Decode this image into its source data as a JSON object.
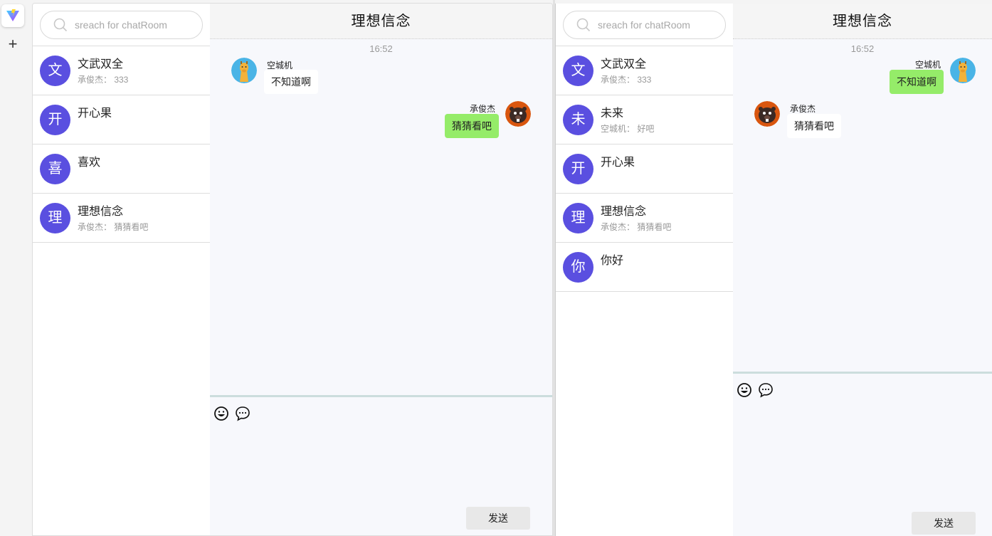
{
  "left_window": {
    "search": {
      "placeholder": "sreach for chatRoom"
    },
    "rooms": [
      {
        "avatar": "文",
        "name": "文武双全",
        "last": "承俊杰：  333"
      },
      {
        "avatar": "开",
        "name": "开心果",
        "last": ""
      },
      {
        "avatar": "喜",
        "name": "喜欢",
        "last": ""
      },
      {
        "avatar": "理",
        "name": "理想信念",
        "last": "承俊杰：  猜猜看吧"
      }
    ],
    "chat": {
      "title": "理想信念",
      "time": "16:52",
      "messages": [
        {
          "sender": "空城机",
          "text": "不知道啊",
          "side": "left"
        },
        {
          "sender": "承俊杰",
          "text": "猜猜看吧",
          "side": "right"
        }
      ],
      "send_label": "发送"
    }
  },
  "right_window": {
    "search": {
      "placeholder": "sreach for chatRoom"
    },
    "rooms": [
      {
        "avatar": "文",
        "name": "文武双全",
        "last": "承俊杰：  333"
      },
      {
        "avatar": "未",
        "name": "未来",
        "last": "空城机：  好吧"
      },
      {
        "avatar": "开",
        "name": "开心果",
        "last": ""
      },
      {
        "avatar": "理",
        "name": "理想信念",
        "last": "承俊杰：  猜猜看吧"
      },
      {
        "avatar": "你",
        "name": "你好",
        "last": ""
      }
    ],
    "chat": {
      "title": "理想信念",
      "time": "16:52",
      "messages": [
        {
          "sender": "空城机",
          "text": "不知道啊",
          "side": "right"
        },
        {
          "sender": "承俊杰",
          "text": "猜猜看吧",
          "side": "left"
        }
      ],
      "send_label": "发送"
    }
  },
  "icons": {
    "app_logo": "vite-logo-icon",
    "add": "plus-icon",
    "search": "search-icon",
    "emoji": "emoji-icon",
    "chat_bubble": "chat-bubble-icon",
    "giraffe_avatar": "giraffe-avatar-icon",
    "beaver_avatar": "beaver-avatar-icon"
  },
  "colors": {
    "room_avatar": "#5a4fe0",
    "bubble_self": "#95ec69",
    "bubble_other": "#ffffff"
  }
}
